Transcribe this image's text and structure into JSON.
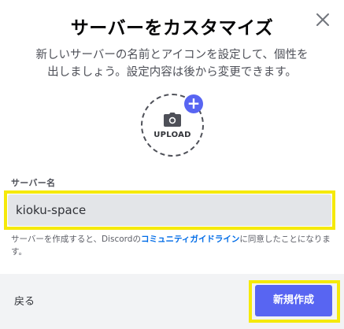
{
  "dialog": {
    "title": "サーバーをカスタマイズ",
    "subtitle_line1": "新しいサーバーの名前とアイコンを設定して、個性を",
    "subtitle_line2": "出しましょう。設定内容は後から変更できます。",
    "close_icon": "close-icon"
  },
  "upload": {
    "label": "UPLOAD",
    "plus": "+",
    "icon": "camera-icon"
  },
  "server_name": {
    "label": "サーバー名",
    "value": "kioku-space"
  },
  "guidelines": {
    "before": "サーバーを作成すると、Discordの",
    "link": "コミュニティガイドライン",
    "after": "に同意したことになります。"
  },
  "footer": {
    "back_label": "戻る",
    "create_label": "新規作成"
  },
  "colors": {
    "accent": "#5865f2",
    "highlight": "#f5e90a",
    "link": "#006ce7",
    "footer_bg": "#f2f3f5",
    "input_bg": "#e3e5e8"
  }
}
